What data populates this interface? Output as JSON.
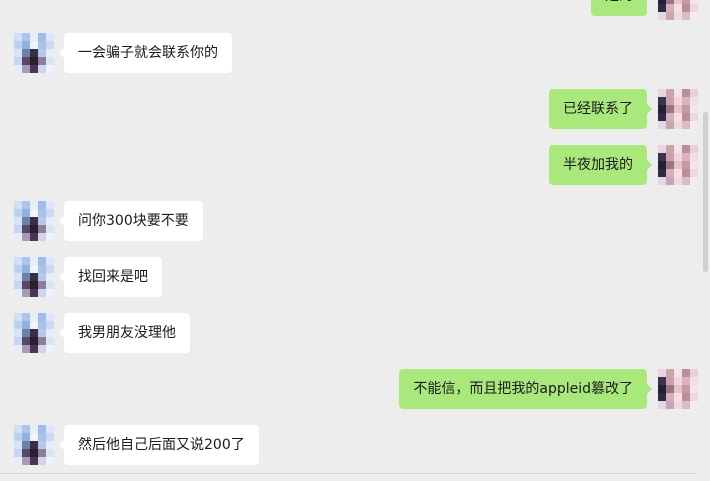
{
  "messages": [
    {
      "side": "right",
      "text": "是的"
    },
    {
      "side": "left",
      "text": "一会骗子就会联系你的"
    },
    {
      "side": "right",
      "text": "已经联系了"
    },
    {
      "side": "right",
      "text": "半夜加我的"
    },
    {
      "side": "left",
      "text": "问你300块要不要"
    },
    {
      "side": "left",
      "text": "找回来是吧"
    },
    {
      "side": "left",
      "text": "我男朋友没理他"
    },
    {
      "side": "right",
      "text": "不能信，而且把我的appleid篡改了"
    },
    {
      "side": "left",
      "text": "然后他自己后面又说200了"
    }
  ],
  "colors": {
    "background": "#ededed",
    "incoming_bubble": "#ffffff",
    "outgoing_bubble": "#a9e87a"
  }
}
